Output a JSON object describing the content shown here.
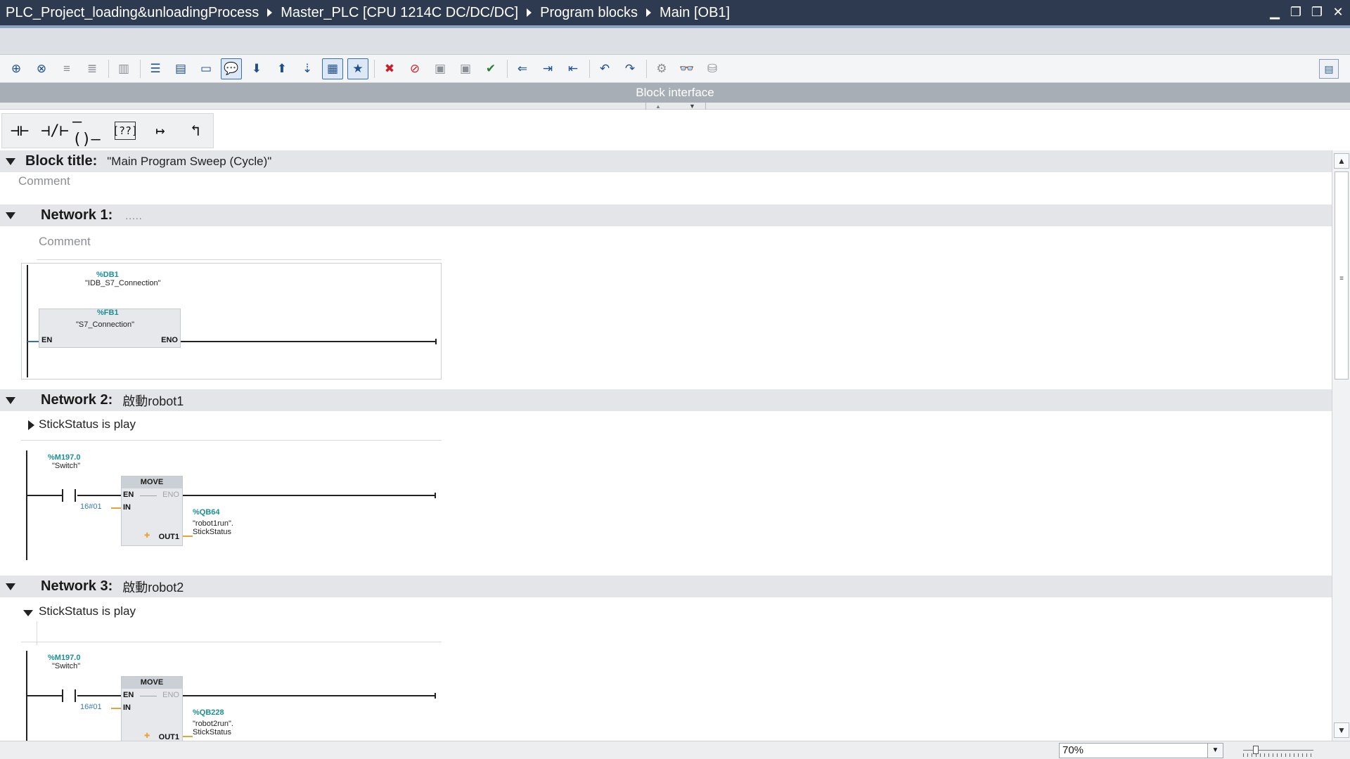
{
  "window": {
    "breadcrumb": [
      "PLC_Project_loading&unloadingProcess",
      "Master_PLC [CPU 1214C DC/DC/DC]",
      "Program blocks",
      "Main [OB1]"
    ],
    "controls": {
      "minimize": "▁",
      "restore": "❐",
      "float": "❐",
      "close": "✕"
    }
  },
  "toolbar": {
    "icons": [
      {
        "name": "insert-network-icon",
        "glyph": "⊕"
      },
      {
        "name": "delete-network-icon",
        "glyph": "⊗"
      },
      {
        "name": "insert-row-icon",
        "glyph": "≡"
      },
      {
        "name": "add-row-icon",
        "glyph": "≣"
      },
      {
        "name": "reset-start-value-icon",
        "glyph": "▥"
      },
      {
        "name": "absolute-operands-icon",
        "glyph": "☰"
      },
      {
        "name": "favorites-icon",
        "glyph": "▤"
      },
      {
        "name": "network-title-icon",
        "glyph": "▭"
      },
      {
        "name": "network-comments-icon",
        "glyph": "💬"
      },
      {
        "name": "open-all-networks-icon",
        "glyph": "⬇"
      },
      {
        "name": "close-all-networks-icon",
        "glyph": "⬆"
      },
      {
        "name": "goto-next-error-icon",
        "glyph": "⇣"
      },
      {
        "name": "display-favorites-icon",
        "glyph": "▦"
      },
      {
        "name": "highlight-icon",
        "glyph": "★"
      },
      {
        "name": "clear-breakpoints-icon",
        "glyph": "✖"
      },
      {
        "name": "disable-breakpoints-icon",
        "glyph": "⊘"
      },
      {
        "name": "monitor-on-icon",
        "glyph": "▣"
      },
      {
        "name": "monitor-off-icon",
        "glyph": "▣"
      },
      {
        "name": "compile-icon",
        "glyph": "✔"
      },
      {
        "name": "go-to-previous-icon",
        "glyph": "⇐"
      },
      {
        "name": "indent-icon",
        "glyph": "⇥"
      },
      {
        "name": "outdent-icon",
        "glyph": "⇤"
      },
      {
        "name": "undo-icon",
        "glyph": "↶"
      },
      {
        "name": "redo-icon",
        "glyph": "↷"
      },
      {
        "name": "connect-online-icon",
        "glyph": "⚙"
      },
      {
        "name": "monitoring-icon",
        "glyph": "👓"
      },
      {
        "name": "database-icon",
        "glyph": "⛁"
      }
    ],
    "panel_toggle": "▤"
  },
  "block_interface": {
    "label": "Block interface"
  },
  "lad_elements": [
    {
      "name": "no-contact-icon",
      "glyph": "⊣⊢"
    },
    {
      "name": "nc-contact-icon",
      "glyph": "⊣/⊢"
    },
    {
      "name": "coil-icon",
      "glyph": "–()–"
    },
    {
      "name": "empty-box-icon",
      "glyph": "[??]"
    },
    {
      "name": "open-branch-icon",
      "glyph": "↦"
    },
    {
      "name": "close-branch-icon",
      "glyph": "↰"
    }
  ],
  "block": {
    "title_label": "Block title:",
    "title_value": "\"Main Program Sweep (Cycle)\"",
    "comment_placeholder": "Comment"
  },
  "networks": [
    {
      "label": "Network 1:",
      "title": ".....",
      "comment": "Comment",
      "instance_db_addr": "%DB1",
      "instance_db_name": "\"IDB_S7_Connection\"",
      "fb_addr": "%FB1",
      "fb_name": "\"S7_Connection\"",
      "pin_en": "EN",
      "pin_eno": "ENO"
    },
    {
      "label": "Network 2:",
      "title": "啟動robot1",
      "comment": "StickStatus is play",
      "contact_addr": "%M197.0",
      "contact_name": "\"Switch\"",
      "block": "MOVE",
      "pin_en": "EN",
      "pin_eno": "ENO",
      "pin_in": "IN",
      "pin_out": "OUT1",
      "in_value": "16#01",
      "out_addr": "%QB64",
      "out_name": "\"robot1run\".",
      "out_member": "StickStatus"
    },
    {
      "label": "Network 3:",
      "title": "啟動robot2",
      "comment": "StickStatus is play",
      "contact_addr": "%M197.0",
      "contact_name": "\"Switch\"",
      "block": "MOVE",
      "pin_en": "EN",
      "pin_eno": "ENO",
      "pin_in": "IN",
      "pin_out": "OUT1",
      "in_value": "16#01",
      "out_addr": "%QB228",
      "out_name": "\"robot2run\".",
      "out_member": "StickStatus"
    }
  ],
  "status": {
    "zoom": "70%"
  }
}
